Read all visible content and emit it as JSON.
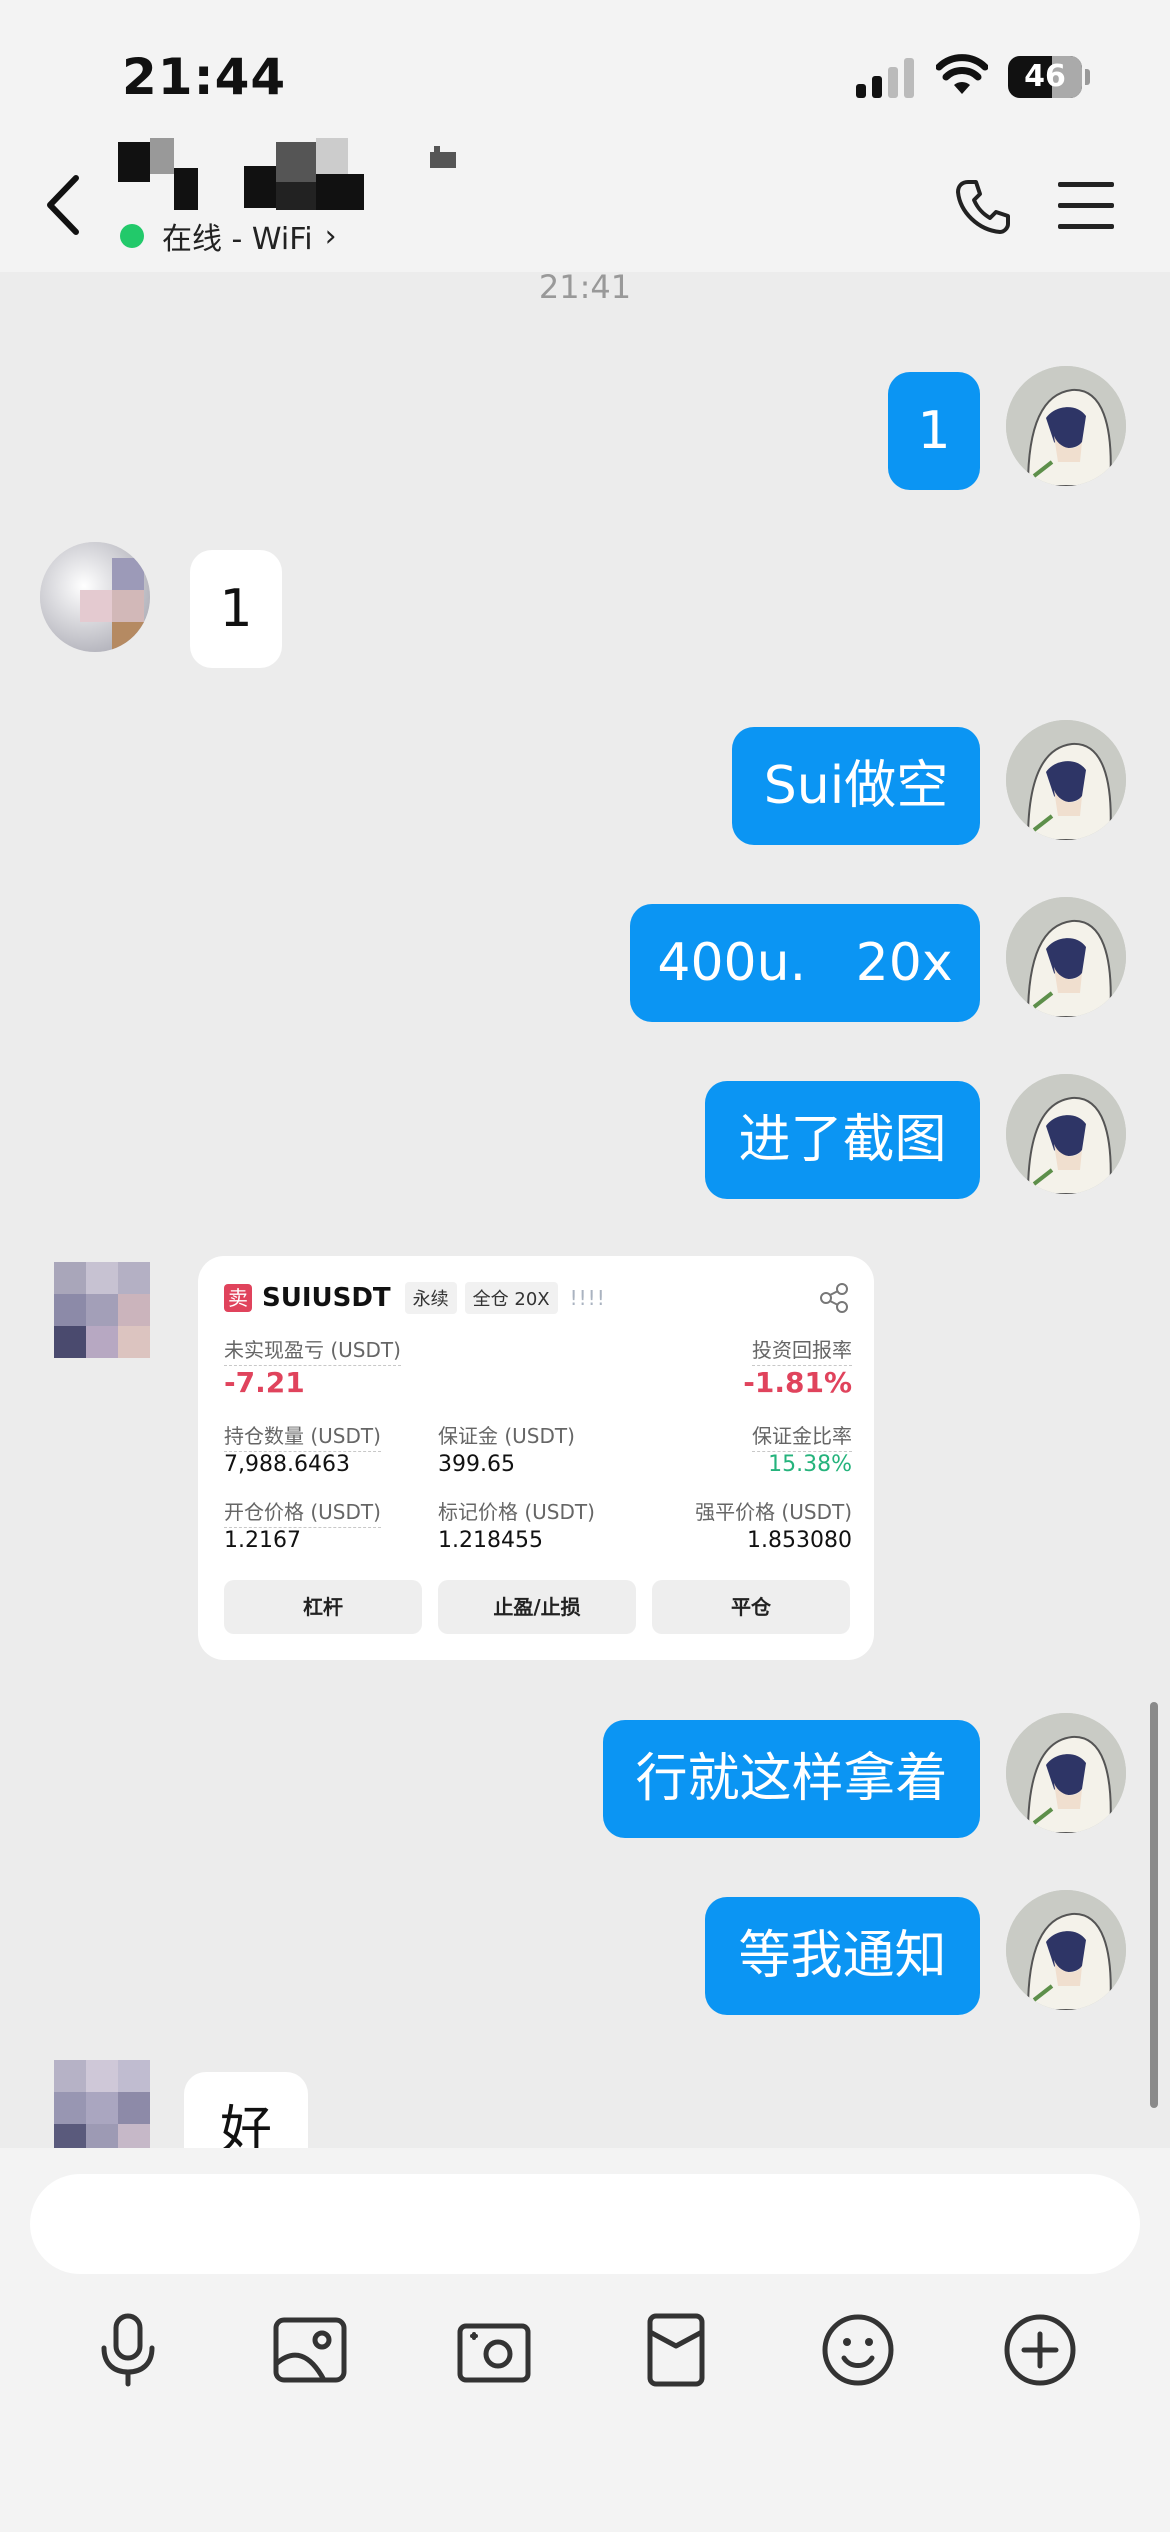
{
  "status_bar": {
    "time": "21:44",
    "battery": "46"
  },
  "header": {
    "presence": "在线 - WiFi"
  },
  "chat": {
    "timestamp": "21:41",
    "messages": [
      {
        "side": "me",
        "text": "1"
      },
      {
        "side": "them",
        "text": "1"
      },
      {
        "side": "me",
        "text": "Sui做空"
      },
      {
        "side": "me",
        "text": "400u.   20x"
      },
      {
        "side": "me",
        "text": "进了截图"
      },
      {
        "side": "me",
        "text": "行就这样拿着"
      },
      {
        "side": "me",
        "text": "等我通知"
      },
      {
        "side": "them",
        "text": "好"
      }
    ]
  },
  "trade_card": {
    "side_tag": "卖",
    "symbol": "SUIUSDT",
    "tag_perpetual": "永续",
    "tag_margin": "全仓 20X",
    "bars": "!!!!",
    "unrealized_pnl_label": "未实现盈亏 (USDT)",
    "unrealized_pnl": "-7.21",
    "roi_label": "投资回报率",
    "roi": "-1.81%",
    "position_qty_label": "持仓数量 (USDT)",
    "position_qty": "7,988.6463",
    "margin_label": "保证金 (USDT)",
    "margin": "399.65",
    "margin_ratio_label": "保证金比率",
    "margin_ratio": "15.38%",
    "entry_price_label": "开仓价格 (USDT)",
    "entry_price": "1.2167",
    "mark_price_label": "标记价格 (USDT)",
    "mark_price": "1.218455",
    "liq_price_label": "强平价格 (USDT)",
    "liq_price": "1.853080",
    "btn_leverage": "杠杆",
    "btn_tpsl": "止盈/止损",
    "btn_close": "平仓"
  },
  "colors": {
    "accent": "#0b95f3",
    "online": "#22c96a",
    "loss": "#e0435c",
    "gain": "#25b37c"
  },
  "toolbar_icons": [
    "microphone-icon",
    "image-icon",
    "camera-icon",
    "red-envelope-icon",
    "emoji-icon",
    "plus-icon"
  ]
}
